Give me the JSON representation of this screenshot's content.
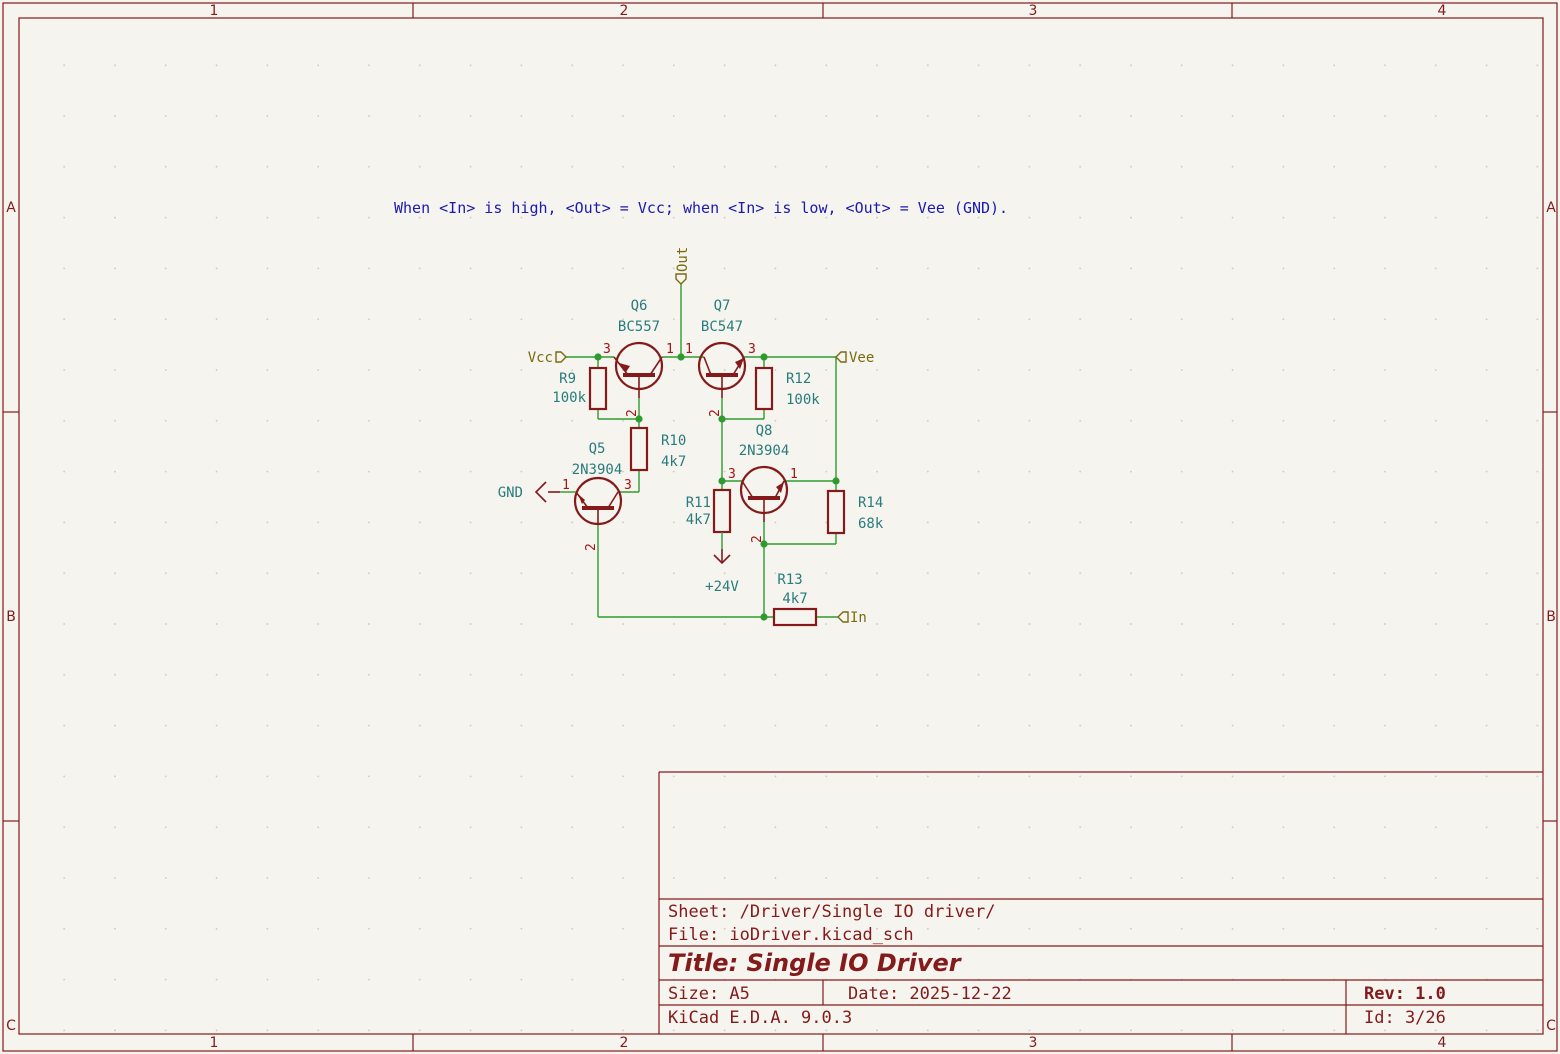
{
  "border": {
    "columns": [
      "1",
      "2",
      "3",
      "4"
    ],
    "rows": [
      "A",
      "B",
      "C"
    ]
  },
  "note": "When <In> is high, <Out> = Vcc; when <In> is low, <Out> = Vee (GND).",
  "components": {
    "Q6": {
      "ref": "Q6",
      "value": "BC557"
    },
    "Q7": {
      "ref": "Q7",
      "value": "BC547"
    },
    "Q5": {
      "ref": "Q5",
      "value": "2N3904"
    },
    "Q8": {
      "ref": "Q8",
      "value": "2N3904"
    },
    "R9": {
      "ref": "R9",
      "value": "100k"
    },
    "R10": {
      "ref": "R10",
      "value": "4k7"
    },
    "R11": {
      "ref": "R11",
      "value": "4k7"
    },
    "R12": {
      "ref": "R12",
      "value": "100k"
    },
    "R13": {
      "ref": "R13",
      "value": "4k7"
    },
    "R14": {
      "ref": "R14",
      "value": "68k"
    }
  },
  "pins": {
    "p1": "1",
    "p2": "2",
    "p3": "3"
  },
  "labels": {
    "out": "Out",
    "vcc": "Vcc",
    "vee": "Vee",
    "in": "In",
    "gnd": "GND",
    "v24": "+24V"
  },
  "title_block": {
    "sheet": "Sheet: /Driver/Single IO driver/",
    "file": "File: ioDriver.kicad_sch",
    "title": "Title: Single IO Driver",
    "size": "Size: A5",
    "date": "Date: 2025-12-22",
    "rev": "Rev: 1.0",
    "tool": "KiCad E.D.A. 9.0.3",
    "id": "Id: 3/26"
  },
  "colors": {
    "frame": "#841a1a",
    "wire": "#2f9b2f",
    "component_text": "#2a7c7c",
    "label": "#7a6a10",
    "note": "#1a1ab0",
    "background": "#f5f4ef"
  }
}
